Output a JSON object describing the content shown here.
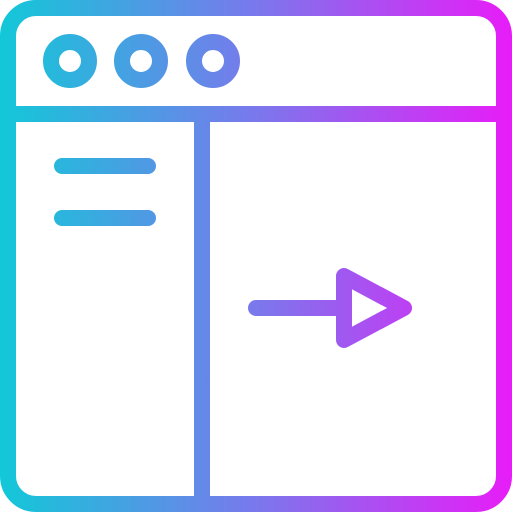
{
  "icon": {
    "name": "browser-window-arrow-icon",
    "gradient": {
      "start": "#12c8d8",
      "mid": "#7a78ec",
      "end": "#e81cf8"
    },
    "window_controls": [
      "circle-control-icon",
      "circle-control-icon",
      "circle-control-icon"
    ],
    "sidebar_lines": 2,
    "main_symbol": "arrow-right-icon"
  }
}
